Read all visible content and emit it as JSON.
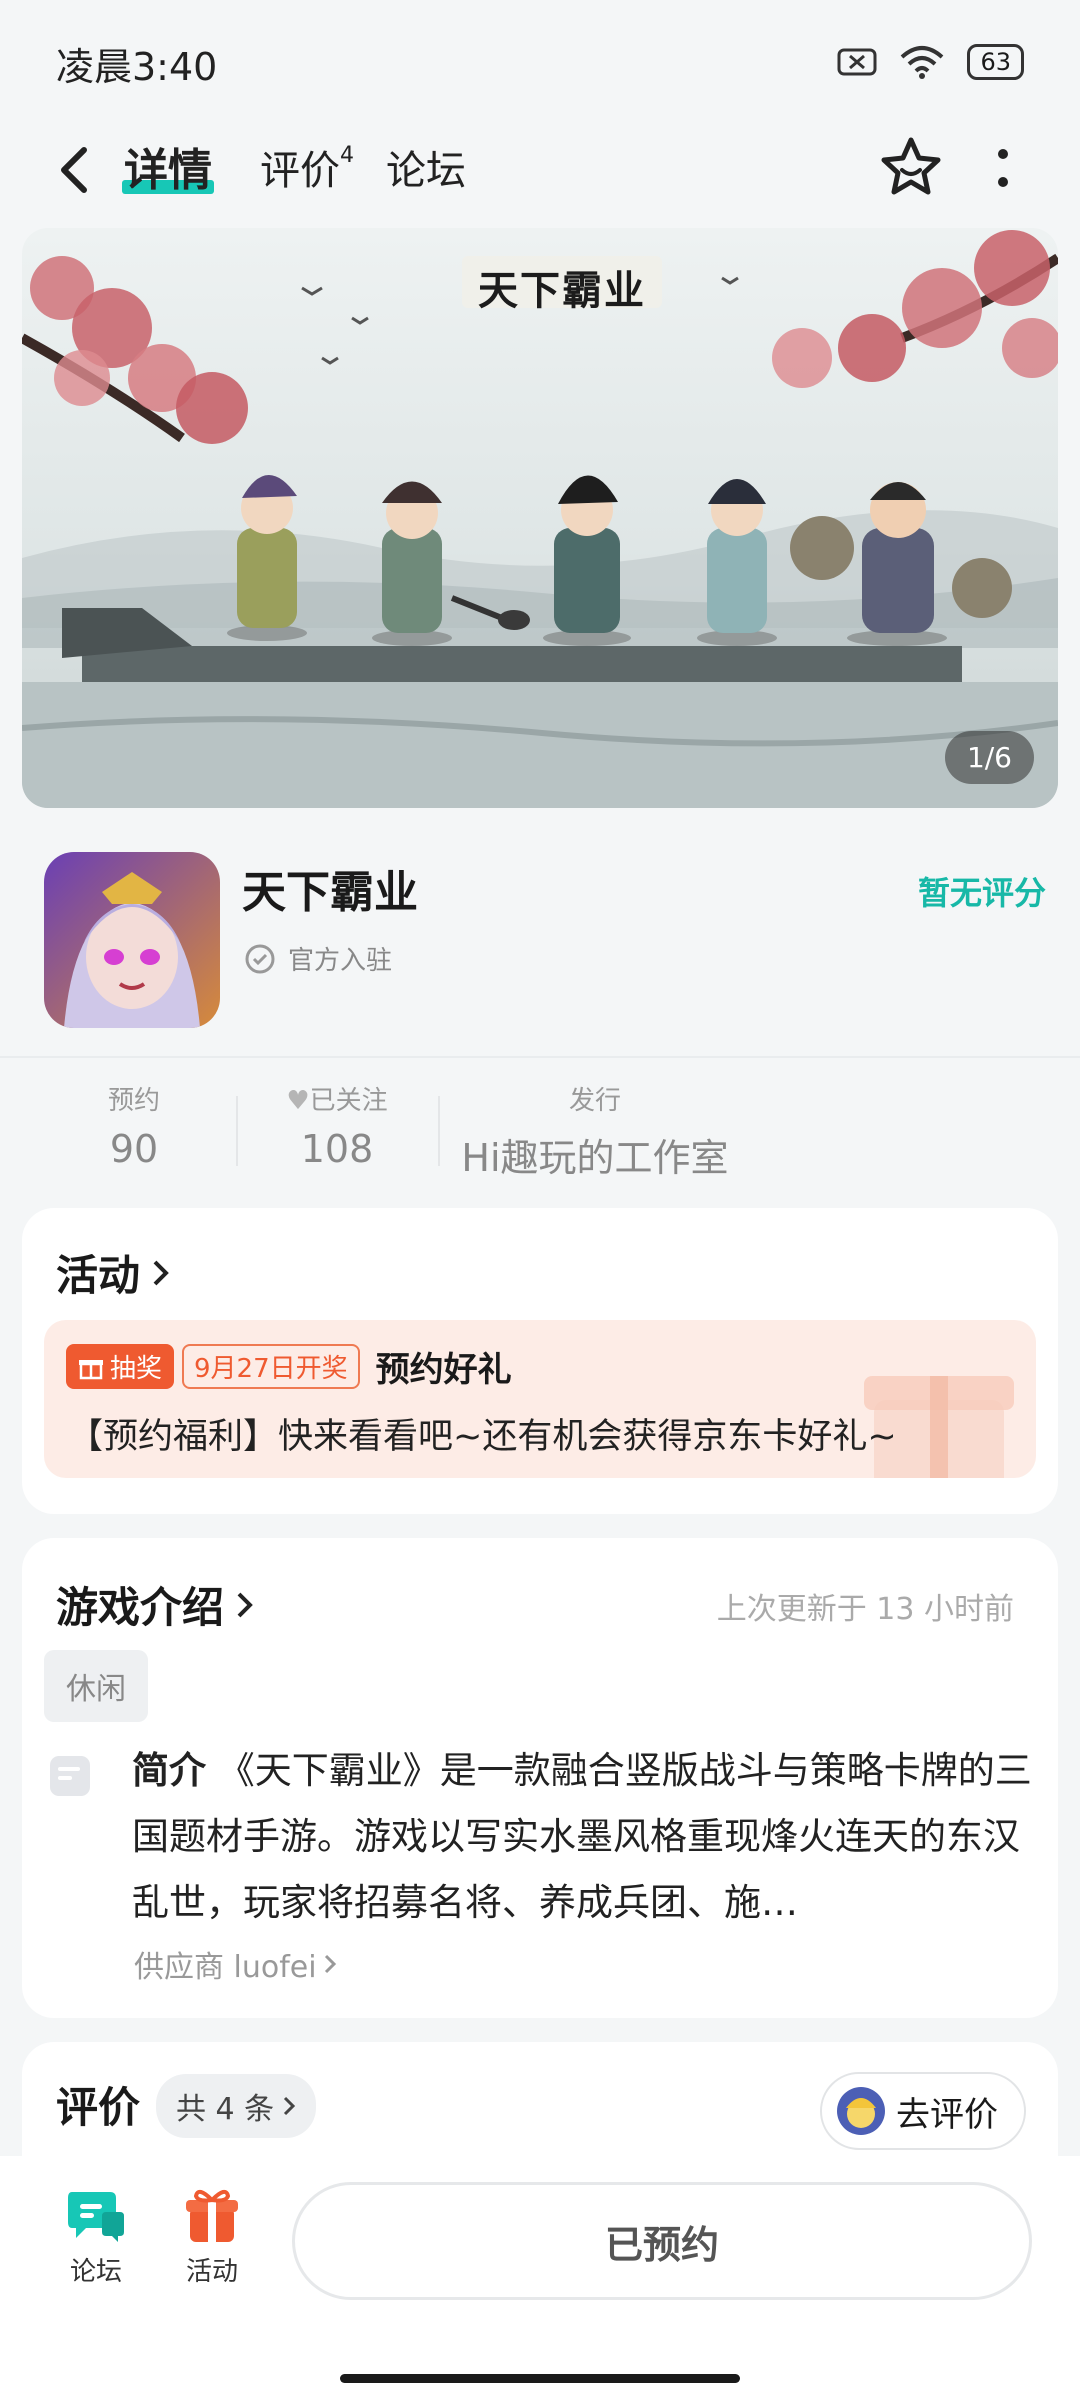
{
  "status": {
    "time": "凌晨3:40",
    "battery": "63"
  },
  "nav": {
    "tabs": [
      {
        "label": "详情"
      },
      {
        "label": "评价",
        "sup": "4"
      },
      {
        "label": "论坛"
      }
    ]
  },
  "banner": {
    "logo_text": "天下霸业",
    "pager": "1/6"
  },
  "app": {
    "name": "天下霸业",
    "official": "官方入驻",
    "rating": "暂无评分"
  },
  "stats": [
    {
      "label": "预约",
      "value": "90"
    },
    {
      "label": "已关注",
      "value": "108"
    },
    {
      "label": "发行",
      "value": "Hi趣玩的工作室"
    }
  ],
  "activity": {
    "title": "活动",
    "badge": "抽奖",
    "date_badge": "9月27日开奖",
    "headline": "预约好礼",
    "desc": "【预约福利】快来看看吧~还有机会获得京东卡好礼~"
  },
  "intro": {
    "title": "游戏介绍",
    "updated": "上次更新于 13 小时前",
    "tag": "休闲",
    "label": "简介",
    "text": "《天下霸业》是一款融合竖版战斗与策略卡牌的三国题材手游。游戏以写实水墨风格重现烽火连天的东汉乱世，玩家将招募名将、养成兵团、施…",
    "supplier": "供应商 luofei"
  },
  "reviews": {
    "title": "评价",
    "count": "共 4 条",
    "rate_button": "去评价"
  },
  "bottom": {
    "forum": "论坛",
    "activity": "活动",
    "reserve": "已预约"
  },
  "colors": {
    "accent": "#17c7b6",
    "orange": "#ef5a30"
  }
}
